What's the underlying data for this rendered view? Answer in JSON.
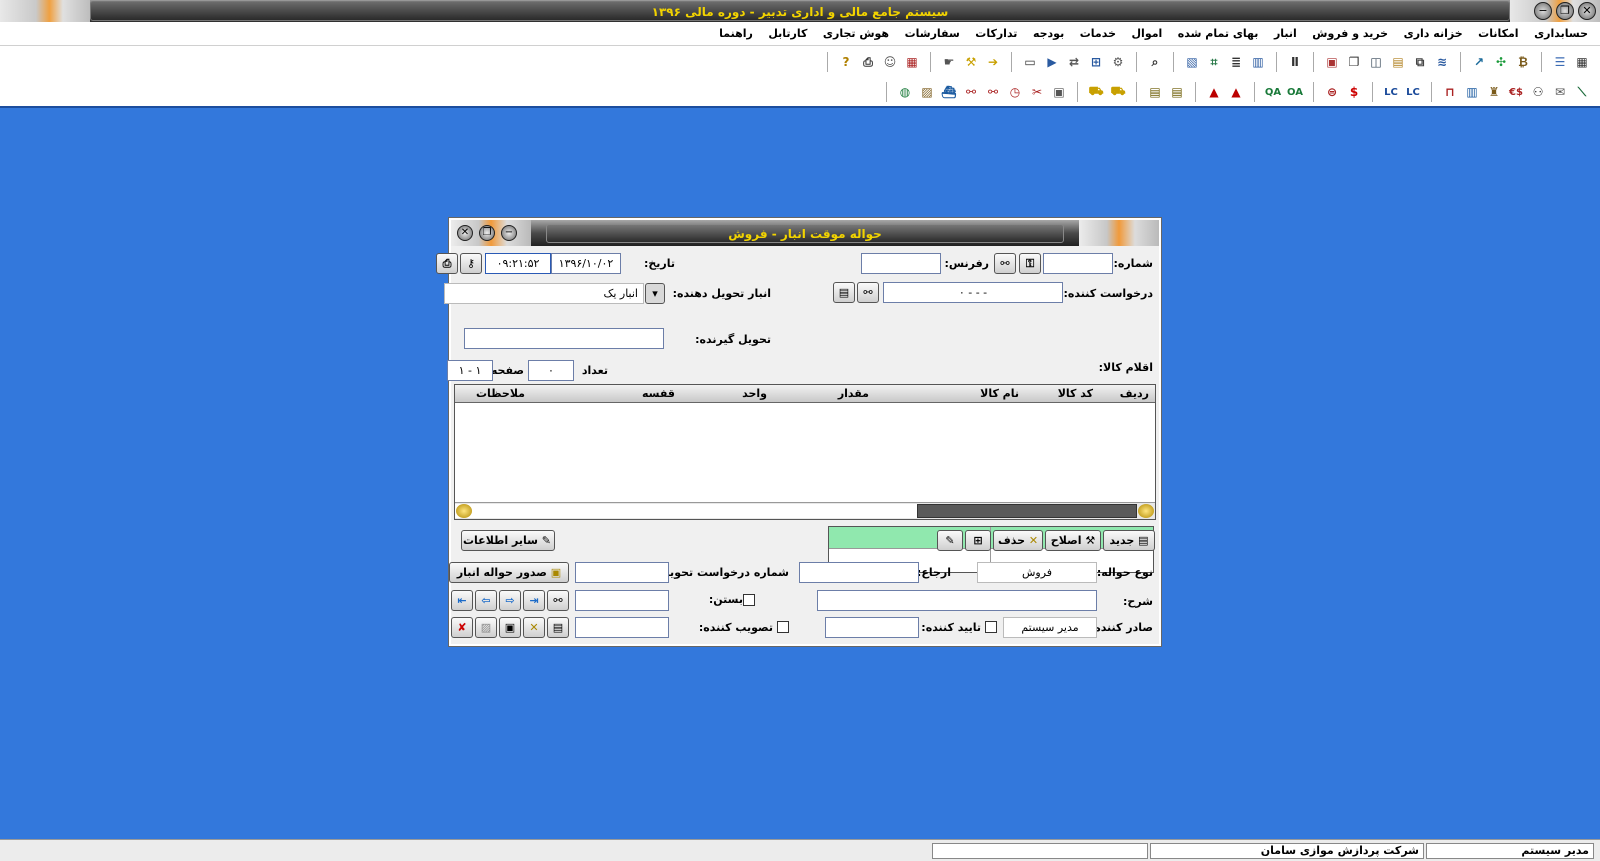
{
  "app": {
    "title": "سیستم جامع مالی و اداری تدبیر - دوره مالی ۱۳۹۶"
  },
  "menu": [
    "حسابداری",
    "امکانات",
    "خزانه داری",
    "خرید و فروش",
    "انبار",
    "بهای تمام شده",
    "اموال",
    "خدمات",
    "بودجه",
    "تدارکات",
    "سفارشات",
    "هوش تجاری",
    "کارتابل",
    "راهنما"
  ],
  "toolbar1_icons": [
    "grid-icon",
    "document-list-icon",
    "money-bag-icon",
    "tree-nodes-icon",
    "chart-up-icon",
    "layers-icon",
    "copy-icon",
    "folder-icon",
    "windows-icon",
    "stacked-windows-icon",
    "bookmark-icon",
    "table-icon",
    "book-icon",
    "list-icon",
    "frame-icon",
    "picture-icon",
    "search-icon",
    "gear-document-icon",
    "network-icon",
    "transfer-icon",
    "video-icon",
    "monitor-icon",
    "arrow-icon",
    "tool-icon",
    "hand-icon",
    "calendar-icon",
    "contact-icon",
    "printer-icon",
    "help-icon"
  ],
  "toolbar2_icons": [
    "chart-line-icon",
    "mail-icon",
    "graph-icon",
    "currency-icon",
    "person-money-icon",
    "books-icon",
    "bars-icon",
    "text-lc-icon",
    "pin-icon",
    "text-lc2-icon",
    "dollar-icon",
    "coin-icon",
    "text-oa-icon",
    "text-qa-icon",
    "letter-a-icon",
    "letter-a2-icon",
    "ledger-icon",
    "ledger2-icon",
    "truck-icon",
    "truck2-icon",
    "box-icon",
    "scissors-icon",
    "clock-icon",
    "binoculars-icon",
    "red-binoculars-icon",
    "ship-icon",
    "id-card-icon",
    "globe-icon"
  ],
  "toolbar2_texts": {
    "oa": "OA",
    "qa": "QA",
    "lc": "LC",
    "dollar_euro": "$€",
    "dollar": "$"
  },
  "window": {
    "title": "حواله موقت انبار - فروش",
    "number_label": "شماره:",
    "number_value": "",
    "reference_label": "رفرنس:",
    "reference_value": "",
    "date_label": "تاریخ:",
    "date_value": "۱۳۹۶/۱۰/۰۲",
    "time_value": "۰۹:۲۱:۵۲",
    "requester_label": "درخواست کننده:",
    "requester_value": "- - - ۰",
    "warehouse_label": "انبار تحویل دهنده:",
    "warehouse_value": "انبار یک",
    "receiver_label": "تحویل گیرنده:",
    "receiver_value": "",
    "items_label": "اقلام کالا:",
    "count_label": "تعداد",
    "count_value": "۰",
    "page_label": "صفحه:",
    "page_value": "۱ - ۱",
    "grid_headers": [
      "ردیف",
      "کد کالا",
      "نام کالا",
      "مقدار",
      "واحد",
      "قفسه",
      "ملاحظات"
    ],
    "new_label": "جدید",
    "edit_label": "اصلاح",
    "delete_label": "حذف",
    "other_info_label": "سایر اطلاعات",
    "issue_btn": "صدور حواله انبار",
    "type_label": "نوع حواله:",
    "type_value": "فروش",
    "return_label": "ارجاع:",
    "return_value": "",
    "delivery_req_label": "شماره درخواست تحویل:",
    "delivery_req_value": "",
    "desc_label": "شرح:",
    "desc_value": "",
    "close_label": "بستن:",
    "issuer_label": "صادر کننده:",
    "issuer_value": "مدیر سیستم",
    "approver_label": "تایید کننده:",
    "approver_value": "",
    "ratifier_label": "تصویب کننده:",
    "ratifier_value": ""
  },
  "status": {
    "user": "مدیر سیستم",
    "company": "شرکت پردازش موازی سامان"
  },
  "colors": {
    "desktop": "#3378dc",
    "title_text": "#f2d300",
    "requester_header": "#90e8ae"
  }
}
